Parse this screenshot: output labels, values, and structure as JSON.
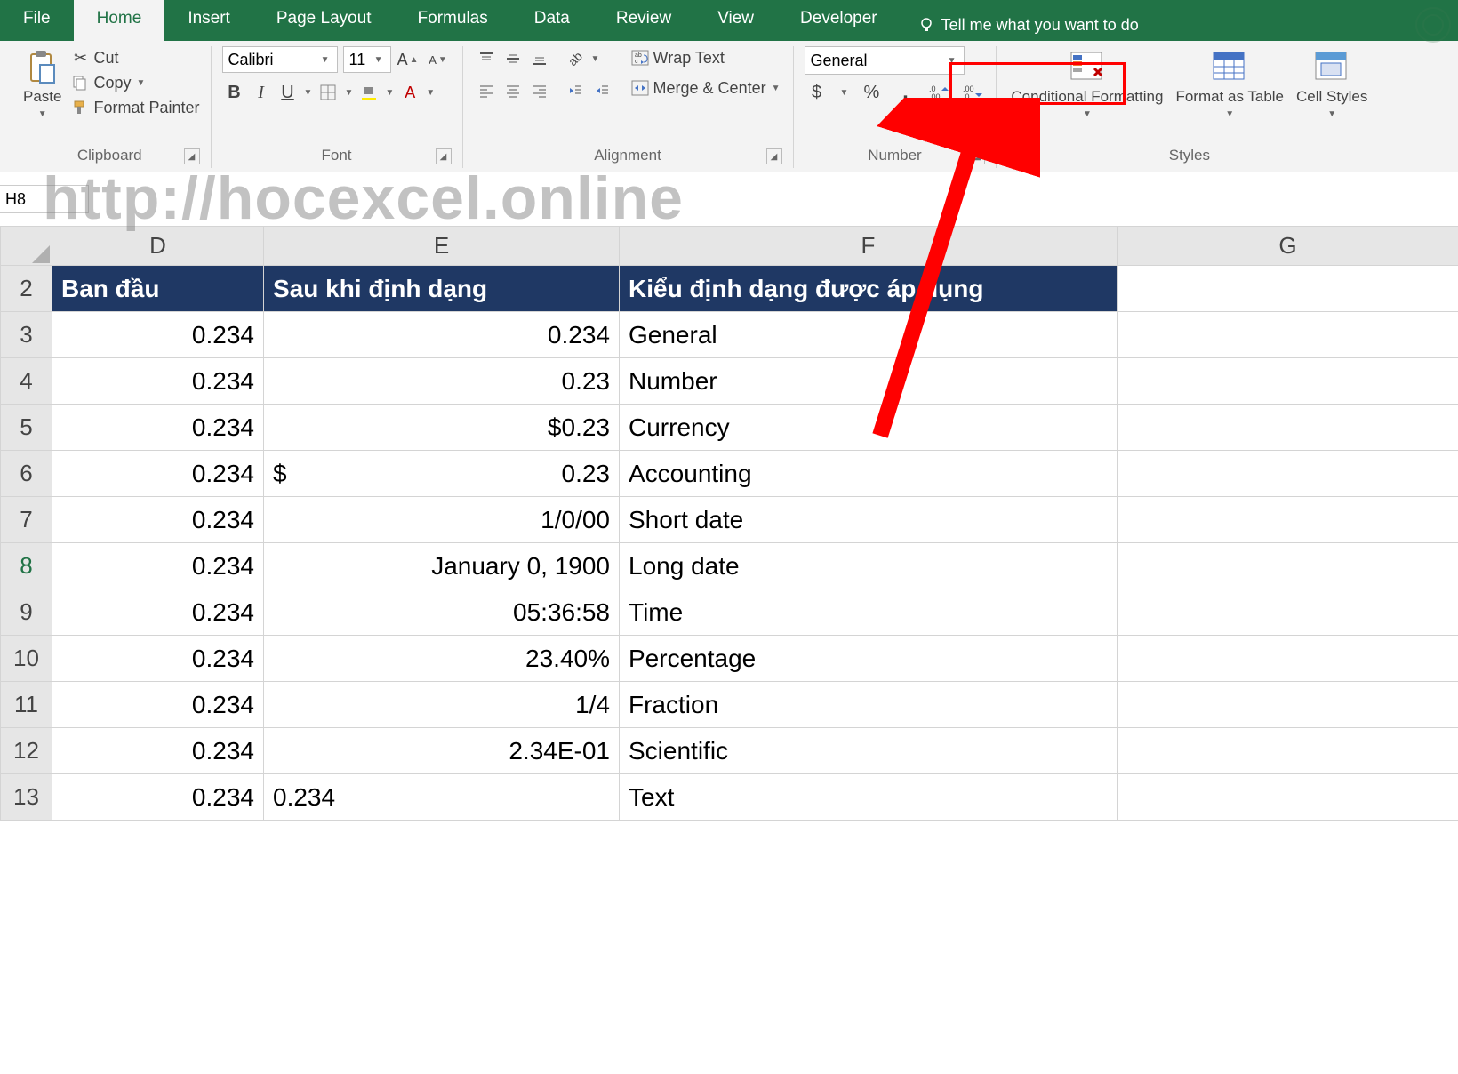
{
  "tabs": [
    "File",
    "Home",
    "Insert",
    "Page Layout",
    "Formulas",
    "Data",
    "Review",
    "View",
    "Developer"
  ],
  "active_tab_index": 1,
  "tellme_placeholder": "Tell me what you want to do",
  "groups": {
    "clipboard": {
      "label": "Clipboard",
      "paste": "Paste",
      "cut": "Cut",
      "copy": "Copy",
      "format_painter": "Format Painter"
    },
    "font": {
      "label": "Font",
      "font_name": "Calibri",
      "font_size": "11",
      "bold": "B",
      "italic": "I",
      "underline": "U"
    },
    "alignment": {
      "label": "Alignment",
      "wrap_text": "Wrap Text",
      "merge_center": "Merge & Center"
    },
    "number": {
      "label": "Number",
      "format": "General",
      "percent": "%",
      "comma": ","
    },
    "styles": {
      "label": "Styles",
      "conditional_fmt": "Conditional Formatting",
      "format_as_table": "Format as Table",
      "cell_styles": "Cell Styles"
    }
  },
  "name_box": "H8",
  "watermark": "http://hocexcel.online",
  "columns": [
    "D",
    "E",
    "F",
    "G"
  ],
  "row_numbers": [
    "2",
    "3",
    "4",
    "5",
    "6",
    "7",
    "8",
    "9",
    "10",
    "11",
    "12",
    "13"
  ],
  "selected_row_index": 6,
  "header_row": {
    "D": "Ban đầu",
    "E": "Sau khi định dạng",
    "F": "Kiểu định dạng được áp dụng"
  },
  "rows": [
    {
      "D": "0.234",
      "E": "0.234",
      "F": "General",
      "align": "right"
    },
    {
      "D": "0.234",
      "E": "0.23",
      "F": "Number",
      "align": "right"
    },
    {
      "D": "0.234",
      "E": "$0.23",
      "F": "Currency",
      "align": "right"
    },
    {
      "D": "0.234",
      "E_prefix": "$",
      "E": "0.23",
      "F": "Accounting",
      "align": "acc"
    },
    {
      "D": "0.234",
      "E": "1/0/00",
      "F": "Short date",
      "align": "right"
    },
    {
      "D": "0.234",
      "E": "January 0, 1900",
      "F": "Long date",
      "align": "right"
    },
    {
      "D": "0.234",
      "E": "05:36:58",
      "F": "Time",
      "align": "right"
    },
    {
      "D": "0.234",
      "E": "23.40%",
      "F": "Percentage",
      "align": "right"
    },
    {
      "D": "0.234",
      "E": "1/4",
      "F": "Fraction",
      "align": "right"
    },
    {
      "D": "0.234",
      "E": "2.34E-01",
      "F": "Scientific",
      "align": "right"
    },
    {
      "D": "0.234",
      "E": "0.234",
      "F": "Text",
      "align": "left"
    }
  ]
}
